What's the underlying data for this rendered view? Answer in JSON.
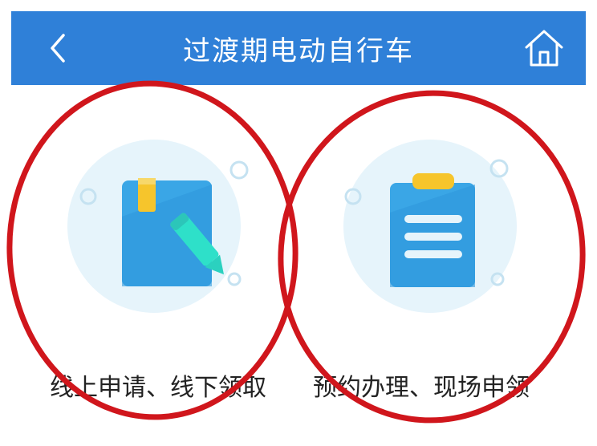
{
  "header": {
    "title": "过渡期电动自行车",
    "back_icon": "chevron-left-icon",
    "home_icon": "home-icon",
    "background_color": "#2f80d8"
  },
  "options": [
    {
      "label": "线上申请、线下领取",
      "icon": "notebook-pencil-icon"
    },
    {
      "label": "预约办理、现场申领",
      "icon": "clipboard-list-icon"
    }
  ],
  "annotations": {
    "circle_color": "#d0161c"
  }
}
